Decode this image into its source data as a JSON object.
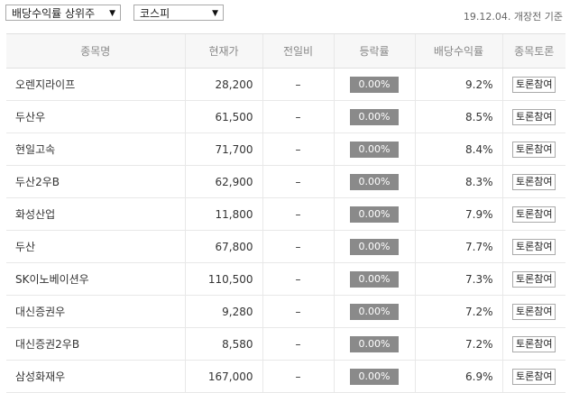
{
  "filters": {
    "category": "배당수익률 상위주",
    "market": "코스피",
    "basis_text": "19.12.04. 개장전 기준"
  },
  "table": {
    "headers": [
      "종목명",
      "현재가",
      "전일비",
      "등락률",
      "배당수익률",
      "종목토론"
    ],
    "forum_label": "토론참여",
    "rows": [
      {
        "name": "오렌지라이프",
        "price": "28,200",
        "diff": "–",
        "rate": "0.00%",
        "yield": "9.2%"
      },
      {
        "name": "두산우",
        "price": "61,500",
        "diff": "–",
        "rate": "0.00%",
        "yield": "8.5%"
      },
      {
        "name": "현일고속",
        "price": "71,700",
        "diff": "–",
        "rate": "0.00%",
        "yield": "8.4%"
      },
      {
        "name": "두산2우B",
        "price": "62,900",
        "diff": "–",
        "rate": "0.00%",
        "yield": "8.3%"
      },
      {
        "name": "화성산업",
        "price": "11,800",
        "diff": "–",
        "rate": "0.00%",
        "yield": "7.9%"
      },
      {
        "name": "두산",
        "price": "67,800",
        "diff": "–",
        "rate": "0.00%",
        "yield": "7.7%"
      },
      {
        "name": "SK이노베이션우",
        "price": "110,500",
        "diff": "–",
        "rate": "0.00%",
        "yield": "7.3%"
      },
      {
        "name": "대신증권우",
        "price": "9,280",
        "diff": "–",
        "rate": "0.00%",
        "yield": "7.2%"
      },
      {
        "name": "대신증권2우B",
        "price": "8,580",
        "diff": "–",
        "rate": "0.00%",
        "yield": "7.2%"
      },
      {
        "name": "삼성화재우",
        "price": "167,000",
        "diff": "–",
        "rate": "0.00%",
        "yield": "6.9%"
      }
    ]
  }
}
